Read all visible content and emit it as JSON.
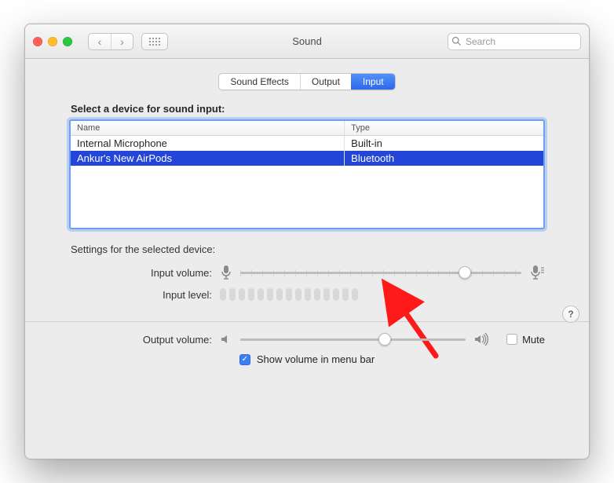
{
  "window": {
    "title": "Sound"
  },
  "toolbar": {
    "search_placeholder": "Search"
  },
  "tabs": {
    "items": [
      {
        "label": "Sound Effects",
        "active": false
      },
      {
        "label": "Output",
        "active": false
      },
      {
        "label": "Input",
        "active": true
      }
    ]
  },
  "input_panel": {
    "heading": "Select a device for sound input:",
    "columns": {
      "name": "Name",
      "type": "Type"
    },
    "devices": [
      {
        "name": "Internal Microphone",
        "type": "Built-in",
        "selected": false
      },
      {
        "name": "Ankur's New AirPods",
        "type": "Bluetooth",
        "selected": true
      }
    ],
    "settings_heading": "Settings for the selected device:",
    "input_volume_label": "Input volume:",
    "input_volume_percent": 80,
    "input_level_label": "Input level:",
    "input_level_segments": 15
  },
  "output": {
    "label": "Output volume:",
    "percent": 64,
    "mute_label": "Mute",
    "mute_checked": false
  },
  "menubar": {
    "label": "Show volume in menu bar",
    "checked": true
  },
  "help_label": "?"
}
